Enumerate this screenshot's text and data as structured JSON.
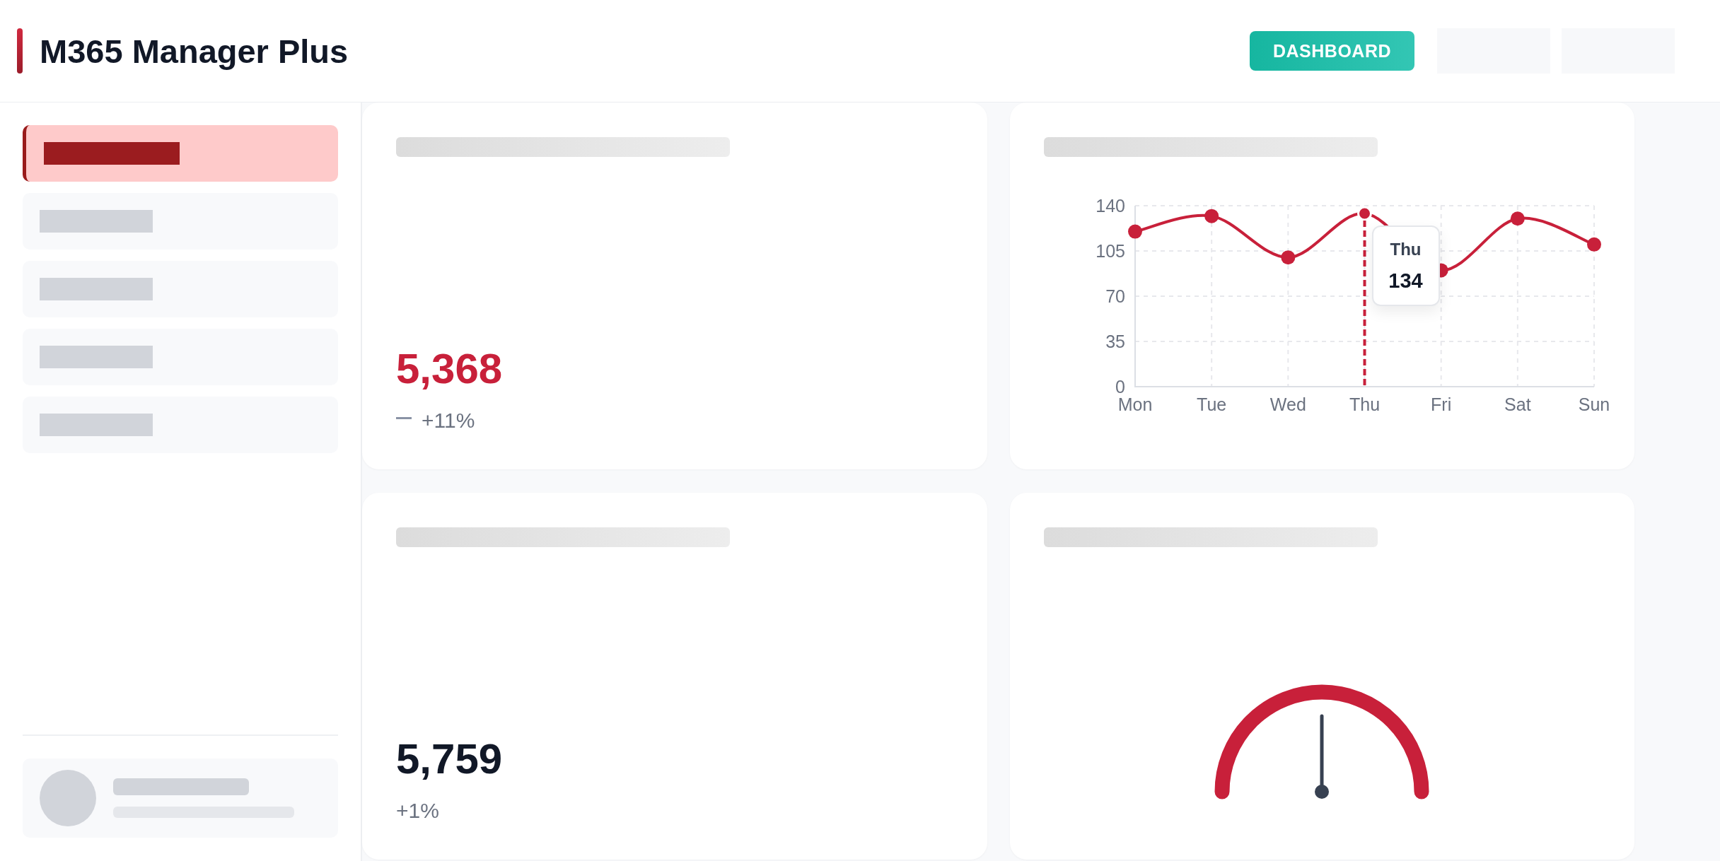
{
  "header": {
    "title": "M365 Manager Plus",
    "button": "DASHBOARD"
  },
  "sidebar": {
    "items": [
      {
        "selected": true
      },
      {
        "selected": false
      },
      {
        "selected": false
      },
      {
        "selected": false
      },
      {
        "selected": false
      }
    ]
  },
  "cards": [
    {
      "kind": "stat",
      "value": "5,368",
      "alert": true,
      "trend": {
        "kind": "flat"
      },
      "change": "+11%"
    },
    {
      "kind": "line_chart",
      "tooltip": {
        "label": "Thu",
        "value": "134"
      },
      "chart_data": {
        "type": "line",
        "categories": [
          "Mon",
          "Tue",
          "Wed",
          "Thu",
          "Fri",
          "Sat",
          "Sun"
        ],
        "ylim": [
          0,
          140
        ],
        "yticks": [
          0,
          35,
          70,
          105,
          140
        ],
        "grid": true,
        "series": [
          {
            "color": "#c8203a",
            "marker": true,
            "values": [
              120,
              132,
              100,
              134,
              90,
              130,
              110
            ]
          }
        ]
      }
    },
    {
      "kind": "stat",
      "value": "5,759",
      "alert": false,
      "change": "+1%"
    },
    {
      "kind": "gauge"
    }
  ]
}
